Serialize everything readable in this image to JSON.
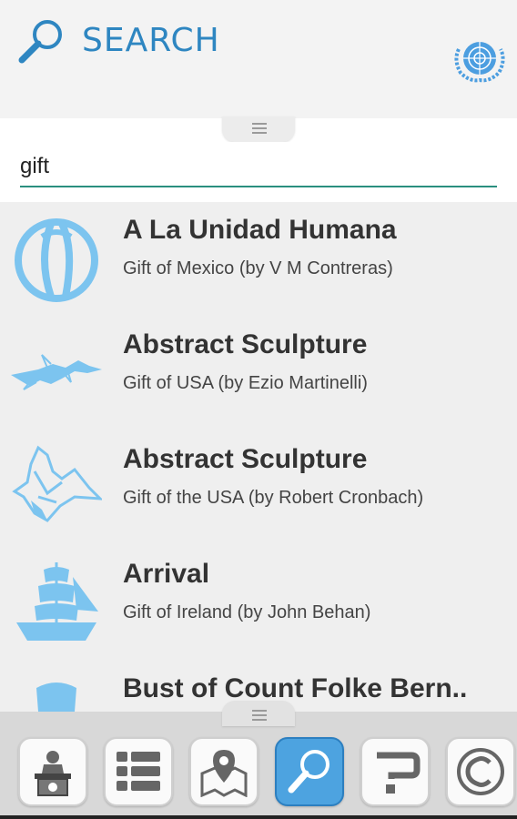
{
  "header": {
    "title": "SEARCH",
    "search_icon": "magnifier-icon",
    "logo": "un-emblem"
  },
  "search": {
    "value": "gift",
    "placeholder": ""
  },
  "results": [
    {
      "name": "A La Unidad Humana",
      "subtitle": "Gift of Mexico (by V M Contreras)",
      "icon": "sphere-sculpture-icon"
    },
    {
      "name": "Abstract Sculpture",
      "subtitle": "Gift of USA (by Ezio Martinelli)",
      "icon": "abstract-sculpture-icon"
    },
    {
      "name": "Abstract Sculpture",
      "subtitle": "Gift of the USA (by Robert Cronbach)",
      "icon": "abstract-sculpture-2-icon"
    },
    {
      "name": "Arrival",
      "subtitle": "Gift of Ireland (by John Behan)",
      "icon": "ship-icon"
    },
    {
      "name": "Bust of Count Folke Bern..",
      "subtitle": "",
      "icon": "bust-icon"
    }
  ],
  "tabs": [
    {
      "name": "info-desk",
      "icon": "info-desk-icon",
      "active": false
    },
    {
      "name": "list",
      "icon": "list-icon",
      "active": false
    },
    {
      "name": "map",
      "icon": "map-pin-icon",
      "active": false
    },
    {
      "name": "search",
      "icon": "search-icon",
      "active": true
    },
    {
      "name": "help",
      "icon": "question-icon",
      "active": false
    },
    {
      "name": "copyright",
      "icon": "copyright-icon",
      "active": false
    }
  ],
  "colors": {
    "accent": "#2e86c1",
    "light_blue": "#7cc4ef",
    "underline": "#2a8f7f",
    "active_tab": "#4da3e0"
  }
}
